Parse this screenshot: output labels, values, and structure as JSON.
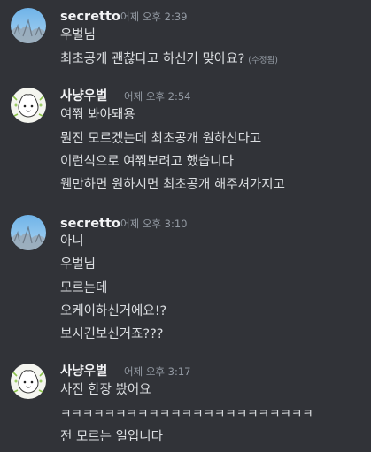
{
  "messages": [
    {
      "author": "secretto",
      "avatar": "sky-tree-photo-avatar",
      "time": "어제 오후 2:39",
      "lines": [
        "우벌님",
        "최초공개 괜찮다고 하신거 맞아요?"
      ],
      "edited_label": "(수정됨)"
    },
    {
      "author": "사냥우벌",
      "avatar": "cartoon-character-avatar",
      "time": "어제 오후 2:54",
      "lines": [
        "여쭤 봐야돼용",
        "뭔진 모르겠는데 최초공개 원하신다고",
        "이런식으로 여쭤보려고 했습니다",
        "웬만하면 원하시면 최초공개 해주셔가지고"
      ]
    },
    {
      "author": "secretto",
      "avatar": "sky-tree-photo-avatar",
      "time": "어제 오후 3:10",
      "lines": [
        "아니",
        "우벌님",
        "모르는데",
        "오케이하신거에요!?",
        "보시긴보신거죠???"
      ]
    },
    {
      "author": "사냥우벌",
      "avatar": "cartoon-character-avatar",
      "time": "어제 오후 3:17",
      "lines": [
        "사진 한장 봤어요",
        "ㅋㅋㅋㅋㅋㅋㅋㅋㅋㅋㅋㅋㅋㅋㅋㅋㅋㅋㅋㅋㅋㅋㅋ",
        "전 모르는 일입니다"
      ]
    }
  ],
  "colors": {
    "background": "#313338",
    "username": "#f2f3f5",
    "message_text": "#dbdee1",
    "timestamp": "#949ba4"
  }
}
